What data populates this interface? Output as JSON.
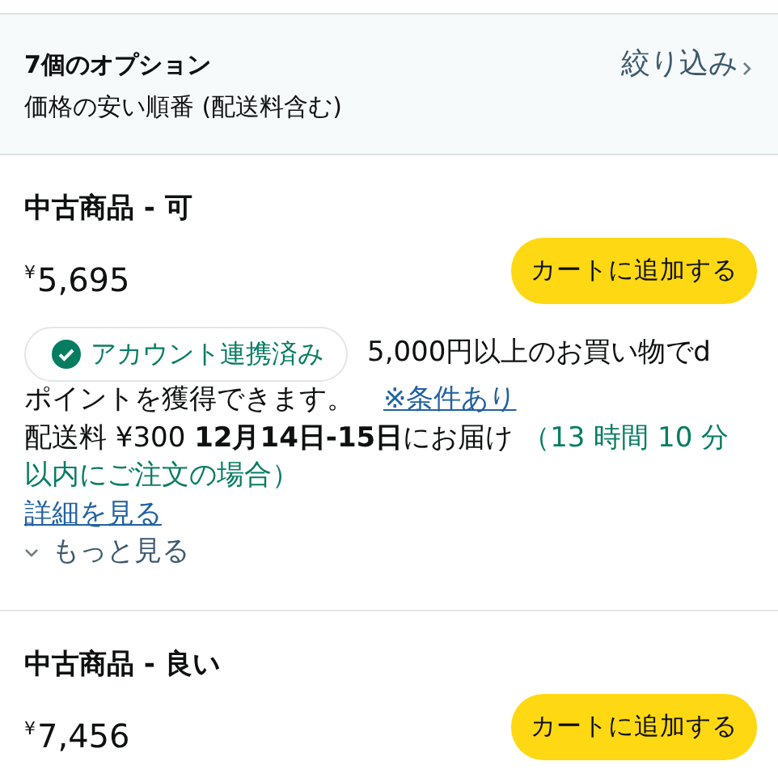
{
  "header": {
    "title": "7個のオプション",
    "subtitle": "価格の安い順番 (配送料含む)",
    "filter_link": "絞り込み"
  },
  "offers": [
    {
      "condition": "中古商品 - 可",
      "currency": "¥",
      "price": "5,695",
      "button": "カートに追加する",
      "badge": "アカウント連携済み",
      "points_lines": [
        "5,000円以上のお買い物でd",
        "ポイントを獲得できます。"
      ],
      "points_link": "※条件あり",
      "delivery": "配送料 ¥300 **12月14日-15日**にお届け",
      "countdown_lines": [
        "（13 時間 10 分",
        "以内にご注文の場合）"
      ],
      "details_link": "詳細を見る",
      "more_link": "もっと見る"
    },
    {
      "condition": "中古商品 - 良い",
      "currency": "¥",
      "price": "7,456",
      "button": "カートに追加する"
    }
  ]
}
